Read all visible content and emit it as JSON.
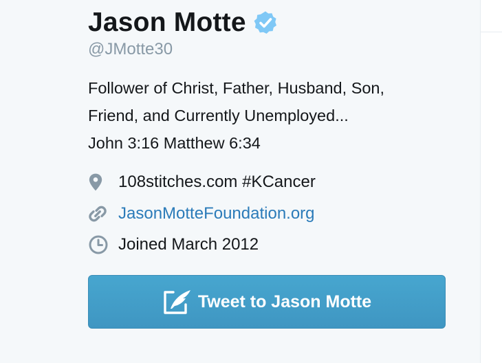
{
  "profile": {
    "name": "Jason Motte",
    "verified_icon": "verified-badge-icon",
    "handle": "@JMotte30",
    "bio_lines": [
      "Follower of Christ, Father, Husband, Son,",
      "Friend, and Currently Unemployed...",
      "John 3:16 Matthew 6:34"
    ],
    "location": "108stitches.com #KCancer",
    "website": "JasonMotteFoundation.org",
    "joined": "Joined March 2012"
  },
  "actions": {
    "tweet_to_label": "Tweet to Jason Motte"
  },
  "colors": {
    "background": "#f5f8fa",
    "text": "#14171a",
    "muted": "#8899a6",
    "link": "#2b7bb9",
    "verified": "#1da1f2",
    "button": "#4aa1cc"
  }
}
